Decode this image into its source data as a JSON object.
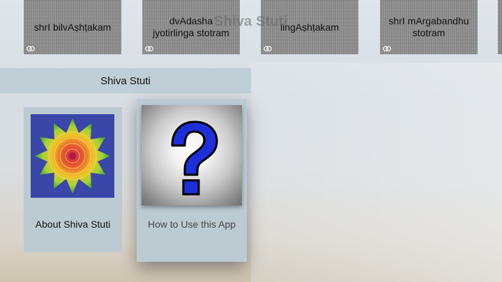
{
  "app": {
    "ghost_title": "Shiva Stuti"
  },
  "top_row": [
    {
      "label": "shrI bilvAṣhṭakam"
    },
    {
      "label": "dvAdasha jyotirlinga stotram"
    },
    {
      "label": "lingAṣhṭakam"
    },
    {
      "label": "shrI mArgabandhu stotram"
    }
  ],
  "section": {
    "title": "Shiva Stuti"
  },
  "cards": [
    {
      "caption": "About Shiva Stuti",
      "icon": "mandala-flower-icon"
    },
    {
      "caption": "How to Use this App",
      "icon": "question-mark-icon"
    }
  ],
  "colors": {
    "header_bar": "#bccbd2",
    "question_mark": "#1f2fd8",
    "tile": "#8f8f8f"
  }
}
